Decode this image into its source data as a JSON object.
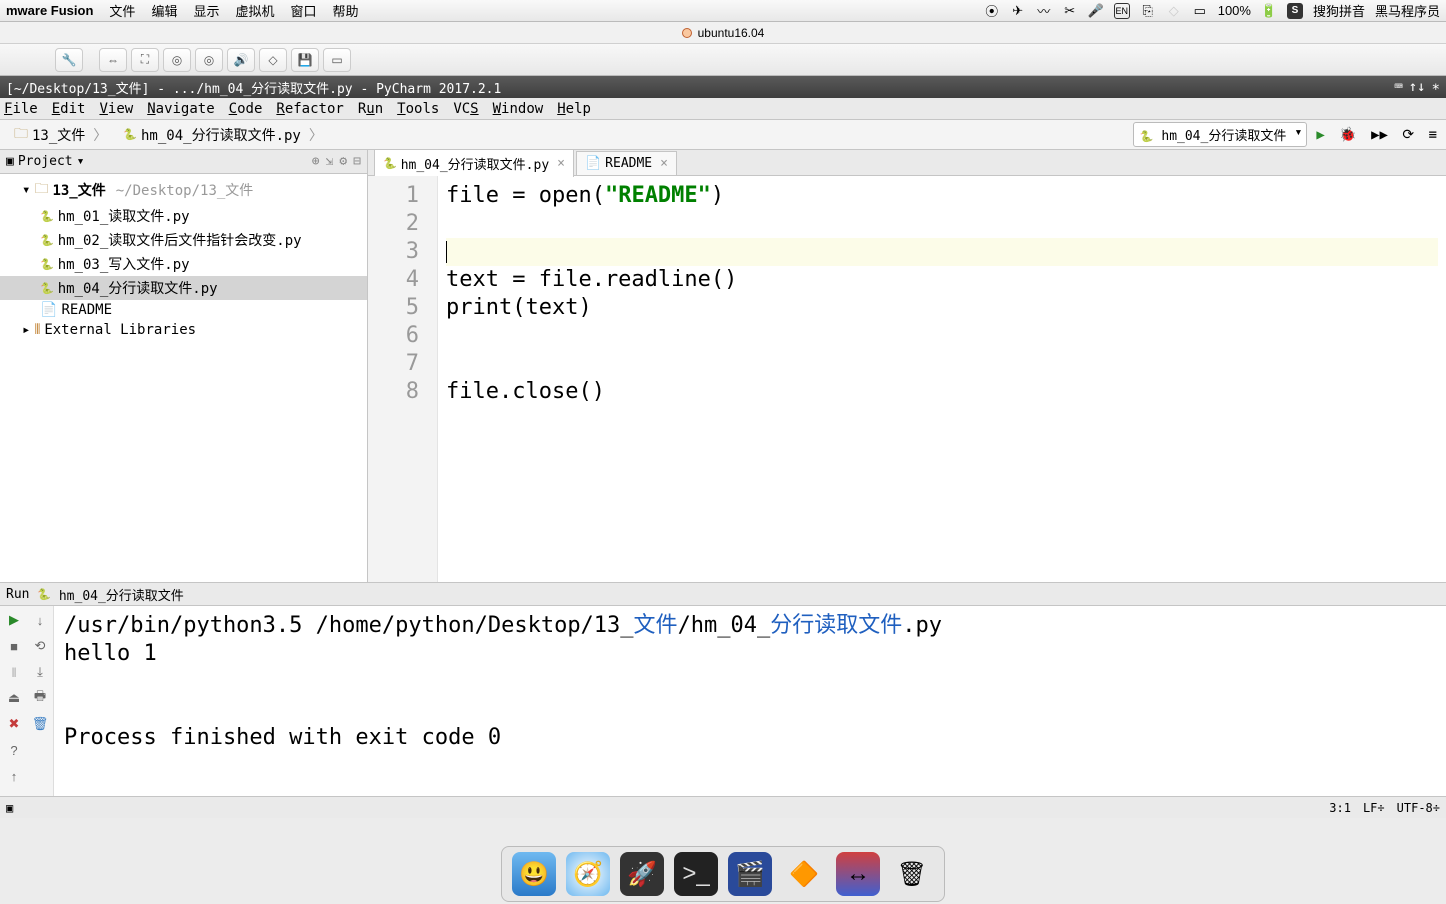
{
  "mac_menu": {
    "app": "mware Fusion",
    "items": [
      "文件",
      "编辑",
      "显示",
      "虚拟机",
      "窗口",
      "帮助"
    ],
    "right": {
      "battery": "100%",
      "ime": "搜狗拼音",
      "user": "黑马程序员"
    }
  },
  "vm_title": "ubuntu16.04",
  "pycharm": {
    "title": "[~/Desktop/13_文件] - .../hm_04_分行读取文件.py - PyCharm 2017.2.1",
    "menu": [
      "File",
      "Edit",
      "View",
      "Navigate",
      "Code",
      "Refactor",
      "Run",
      "Tools",
      "VCS",
      "Window",
      "Help"
    ],
    "breadcrumb": [
      "13_文件",
      "hm_04_分行读取文件.py"
    ],
    "run_config": "hm_04_分行读取文件",
    "project_panel": {
      "title": "Project",
      "root": "13_文件",
      "root_path": "~/Desktop/13_文件",
      "files": [
        "hm_01_读取文件.py",
        "hm_02_读取文件后文件指针会改变.py",
        "hm_03_写入文件.py",
        "hm_04_分行读取文件.py",
        "README"
      ],
      "selected": "hm_04_分行读取文件.py",
      "external": "External Libraries"
    },
    "tabs": [
      {
        "name": "hm_04_分行读取文件.py",
        "active": true
      },
      {
        "name": "README",
        "active": false
      }
    ],
    "code": {
      "lines": [
        "1",
        "2",
        "3",
        "4",
        "5",
        "6",
        "7",
        "8"
      ],
      "l1a": "file = open(",
      "l1b": "\"README\"",
      "l1c": ")",
      "l4": "text = file.readline()",
      "l5": "print(text)",
      "l8": "file.close()"
    },
    "run": {
      "label": "Run",
      "name": "hm_04_分行读取文件",
      "out_cmd_a": "/usr/bin/python3.5 /home/python/Desktop/13_",
      "out_cmd_b": "文件",
      "out_cmd_c": "/hm_04_",
      "out_cmd_d": "分行读取文件",
      "out_cmd_e": ".py",
      "out_hello": "hello 1",
      "out_exit": "Process finished with exit code 0"
    },
    "status": {
      "pos": "3:1",
      "lf": "LF÷",
      "enc": "UTF-8÷"
    }
  }
}
